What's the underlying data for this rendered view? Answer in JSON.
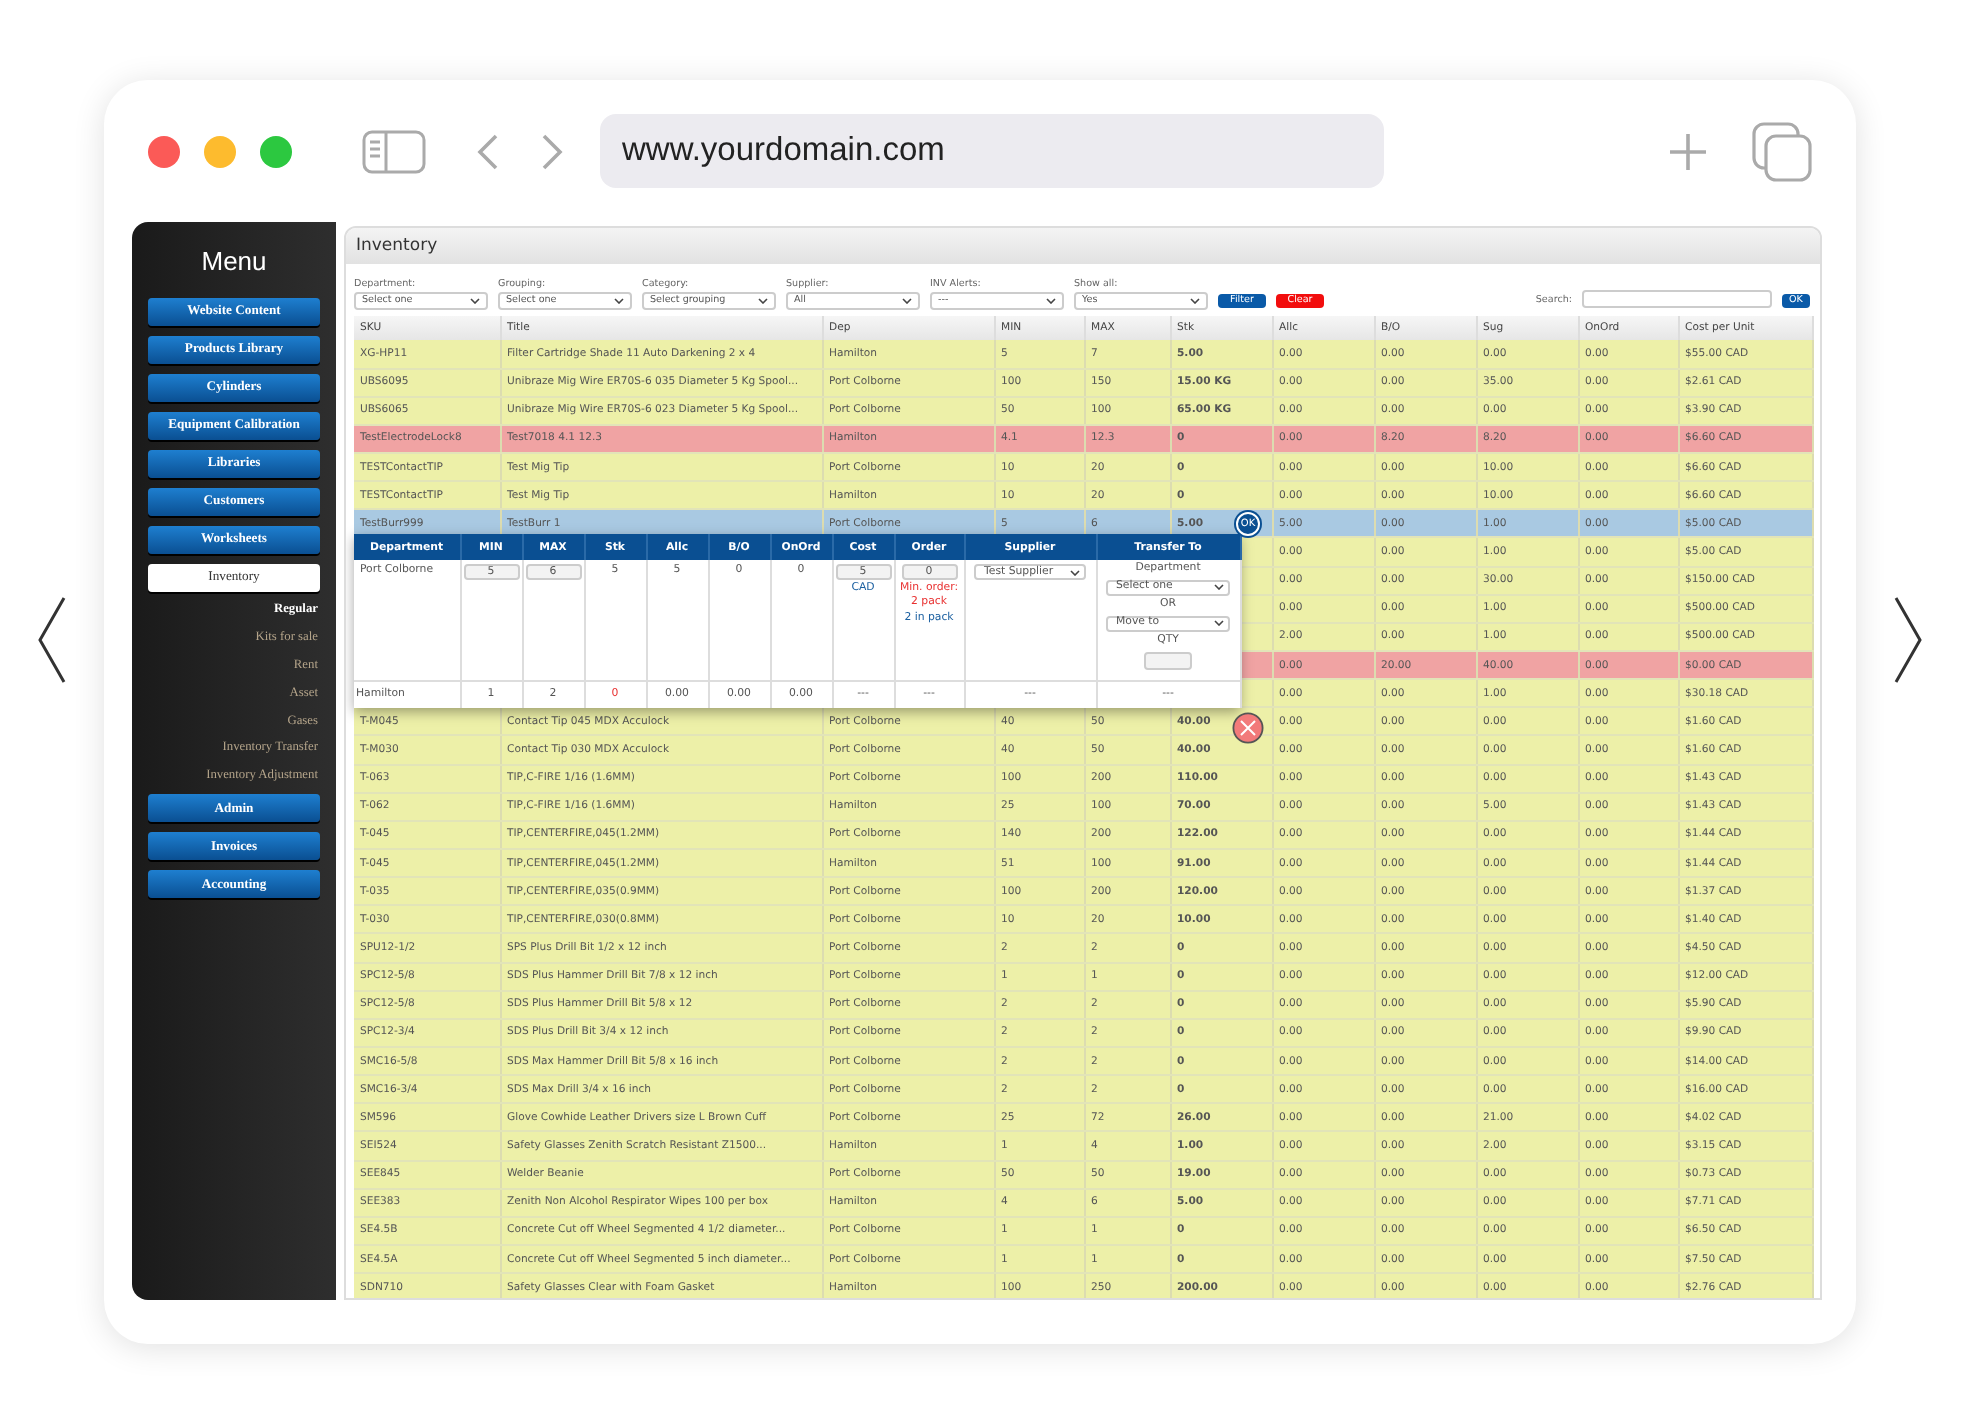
{
  "browser": {
    "url": "www.yourdomain.com"
  },
  "sidebar": {
    "title": "Menu",
    "items": [
      {
        "label": "Website Content",
        "kind": "button",
        "selected": false
      },
      {
        "label": "Products Library",
        "kind": "button",
        "selected": false
      },
      {
        "label": "Cylinders",
        "kind": "button",
        "selected": false
      },
      {
        "label": "Equipment Calibration",
        "kind": "button",
        "selected": false
      },
      {
        "label": "Libraries",
        "kind": "button",
        "selected": false
      },
      {
        "label": "Customers",
        "kind": "button",
        "selected": false
      },
      {
        "label": "Worksheets",
        "kind": "button",
        "selected": false
      },
      {
        "label": "Inventory",
        "kind": "button",
        "selected": true
      },
      {
        "label": "Regular",
        "kind": "subitem",
        "selected": true
      },
      {
        "label": "Kits for sale",
        "kind": "subitem",
        "selected": false
      },
      {
        "label": "Rent",
        "kind": "subitem",
        "selected": false
      },
      {
        "label": "Asset",
        "kind": "subitem",
        "selected": false
      },
      {
        "label": "Gases",
        "kind": "subitem",
        "selected": false
      },
      {
        "label": "Inventory Transfer",
        "kind": "subitem",
        "selected": false
      },
      {
        "label": "Inventory Adjustment",
        "kind": "subitem",
        "selected": false
      },
      {
        "label": "Admin",
        "kind": "button",
        "selected": false
      },
      {
        "label": "Invoices",
        "kind": "button",
        "selected": false
      },
      {
        "label": "Accounting",
        "kind": "button",
        "selected": false
      }
    ]
  },
  "panel": {
    "title": "Inventory"
  },
  "filters": [
    {
      "label": "Department:",
      "value": "Select one"
    },
    {
      "label": "Grouping:",
      "value": "Select one"
    },
    {
      "label": "Category:",
      "value": "Select grouping"
    },
    {
      "label": "Supplier:",
      "value": "All"
    },
    {
      "label": "INV Alerts:",
      "value": "---"
    },
    {
      "label": "Show all:",
      "value": "Yes"
    }
  ],
  "buttons": [
    {
      "label": "Filter",
      "kind": "primary"
    },
    {
      "label": "Clear",
      "kind": "danger"
    }
  ],
  "search": {
    "label": "Search:",
    "button": "OK"
  },
  "table": {
    "columns": [
      "SKU",
      "Title",
      "Dep",
      "MIN",
      "MAX",
      "Stk",
      "Allc",
      "B/O",
      "Sug",
      "OnOrd",
      "Cost per Unit"
    ],
    "rows": [
      {
        "alert": false,
        "selected": false,
        "cells": [
          "XG-HP11",
          "Filter Cartridge Shade 11 Auto Darkening 2 x 4",
          "Hamilton",
          "5",
          "7",
          "5.00",
          "0.00",
          "0.00",
          "0.00",
          "0.00",
          "$55.00 CAD"
        ]
      },
      {
        "alert": false,
        "selected": false,
        "cells": [
          "UBS6095",
          "Unibraze Mig Wire ER70S-6 035 Diameter 5 Kg Spool...",
          "Port Colborne",
          "100",
          "150",
          "15.00 KG",
          "0.00",
          "0.00",
          "35.00",
          "0.00",
          "$2.61 CAD"
        ]
      },
      {
        "alert": false,
        "selected": false,
        "cells": [
          "UBS6065",
          "Unibraze Mig Wire ER70S-6 023 Diameter 5 Kg Spool...",
          "Port Colborne",
          "50",
          "100",
          "65.00 KG",
          "0.00",
          "0.00",
          "0.00",
          "0.00",
          "$3.90 CAD"
        ]
      },
      {
        "alert": true,
        "selected": false,
        "cells": [
          "TestElectrodeLock8",
          "Test7018 4.1 12.3",
          "Hamilton",
          "4.1",
          "12.3",
          "0",
          "0.00",
          "8.20",
          "8.20",
          "0.00",
          "$6.60 CAD"
        ]
      },
      {
        "alert": false,
        "selected": false,
        "cells": [
          "TESTContactTIP",
          "Test Mig Tip",
          "Port Colborne",
          "10",
          "20",
          "0",
          "0.00",
          "0.00",
          "10.00",
          "0.00",
          "$6.60 CAD"
        ]
      },
      {
        "alert": false,
        "selected": false,
        "cells": [
          "TESTContactTIP",
          "Test Mig Tip",
          "Hamilton",
          "10",
          "20",
          "0",
          "0.00",
          "0.00",
          "10.00",
          "0.00",
          "$6.60 CAD"
        ]
      },
      {
        "alert": false,
        "selected": true,
        "cells": [
          "TestBurr999",
          "TestBurr 1",
          "Port Colborne",
          "5",
          "6",
          "5.00",
          "5.00",
          "0.00",
          "1.00",
          "0.00",
          "$5.00 CAD"
        ]
      },
      {
        "alert": false,
        "selected": false,
        "cells": [
          "0.00",
          "0.00",
          "1.00",
          "0.00",
          "$5.00 CAD"
        ]
      },
      {
        "alert": false,
        "selected": false,
        "cells": [
          "0.00",
          "0.00",
          "30.00",
          "0.00",
          "$150.00 CAD"
        ]
      },
      {
        "alert": false,
        "selected": false,
        "cells": [
          "0.00",
          "0.00",
          "1.00",
          "0.00",
          "$500.00 CAD"
        ]
      },
      {
        "alert": false,
        "selected": false,
        "cells": [
          "2.00",
          "0.00",
          "1.00",
          "0.00",
          "$500.00 CAD"
        ]
      },
      {
        "alert": true,
        "selected": false,
        "cells": [
          "0.00",
          "20.00",
          "40.00",
          "0.00",
          "$0.00 CAD"
        ]
      },
      {
        "alert": false,
        "selected": false,
        "cells": [
          "0.00",
          "0.00",
          "1.00",
          "0.00",
          "$30.18 CAD"
        ]
      },
      {
        "alert": false,
        "selected": false,
        "cells": [
          "T-M045",
          "Contact Tip 045 MDX Acculock",
          "Port Colborne",
          "40",
          "50",
          "40.00",
          "0.00",
          "0.00",
          "0.00",
          "0.00",
          "$1.60 CAD"
        ]
      },
      {
        "alert": false,
        "selected": false,
        "cells": [
          "T-M030",
          "Contact Tip 030 MDX Acculock",
          "Port Colborne",
          "40",
          "50",
          "40.00",
          "0.00",
          "0.00",
          "0.00",
          "0.00",
          "$1.60 CAD"
        ]
      },
      {
        "alert": false,
        "selected": false,
        "cells": [
          "T-063",
          "TIP,C-FIRE 1/16 (1.6MM)",
          "Port Colborne",
          "100",
          "200",
          "110.00",
          "0.00",
          "0.00",
          "0.00",
          "0.00",
          "$1.43 CAD"
        ]
      },
      {
        "alert": false,
        "selected": false,
        "cells": [
          "T-062",
          "TIP,C-FIRE 1/16 (1.6MM)",
          "Hamilton",
          "25",
          "100",
          "70.00",
          "0.00",
          "0.00",
          "5.00",
          "0.00",
          "$1.43 CAD"
        ]
      },
      {
        "alert": false,
        "selected": false,
        "cells": [
          "T-045",
          "TIP,CENTERFIRE,045(1.2MM)",
          "Port Colborne",
          "140",
          "200",
          "122.00",
          "0.00",
          "0.00",
          "0.00",
          "0.00",
          "$1.44 CAD"
        ]
      },
      {
        "alert": false,
        "selected": false,
        "cells": [
          "T-045",
          "TIP,CENTERFIRE,045(1.2MM)",
          "Hamilton",
          "51",
          "100",
          "91.00",
          "0.00",
          "0.00",
          "0.00",
          "0.00",
          "$1.44 CAD"
        ]
      },
      {
        "alert": false,
        "selected": false,
        "cells": [
          "T-035",
          "TIP,CENTERFIRE,035(0.9MM)",
          "Port Colborne",
          "100",
          "200",
          "120.00",
          "0.00",
          "0.00",
          "0.00",
          "0.00",
          "$1.37 CAD"
        ]
      },
      {
        "alert": false,
        "selected": false,
        "cells": [
          "T-030",
          "TIP,CENTERFIRE,030(0.8MM)",
          "Port Colborne",
          "10",
          "20",
          "10.00",
          "0.00",
          "0.00",
          "0.00",
          "0.00",
          "$1.40 CAD"
        ]
      },
      {
        "alert": false,
        "selected": false,
        "cells": [
          "SPU12-1/2",
          "SPS Plus Drill Bit 1/2 x 12 inch",
          "Port Colborne",
          "2",
          "2",
          "0",
          "0.00",
          "0.00",
          "0.00",
          "0.00",
          "$4.50 CAD"
        ]
      },
      {
        "alert": false,
        "selected": false,
        "cells": [
          "SPC12-5/8",
          "SDS Plus Hammer Drill Bit 7/8 x 12 inch",
          "Port Colborne",
          "1",
          "1",
          "0",
          "0.00",
          "0.00",
          "0.00",
          "0.00",
          "$12.00 CAD"
        ]
      },
      {
        "alert": false,
        "selected": false,
        "cells": [
          "SPC12-5/8",
          "SDS Plus Hammer Drill Bit 5/8 x 12",
          "Port Colborne",
          "2",
          "2",
          "0",
          "0.00",
          "0.00",
          "0.00",
          "0.00",
          "$5.90 CAD"
        ]
      },
      {
        "alert": false,
        "selected": false,
        "cells": [
          "SPC12-3/4",
          "SDS Plus Drill Bit 3/4 x 12 inch",
          "Port Colborne",
          "2",
          "2",
          "0",
          "0.00",
          "0.00",
          "0.00",
          "0.00",
          "$9.90 CAD"
        ]
      },
      {
        "alert": false,
        "selected": false,
        "cells": [
          "SMC16-5/8",
          "SDS Max Hammer Drill Bit 5/8 x 16 inch",
          "Port Colborne",
          "2",
          "2",
          "0",
          "0.00",
          "0.00",
          "0.00",
          "0.00",
          "$14.00 CAD"
        ]
      },
      {
        "alert": false,
        "selected": false,
        "cells": [
          "SMC16-3/4",
          "SDS Max Drill 3/4 x 16 inch",
          "Port Colborne",
          "2",
          "2",
          "0",
          "0.00",
          "0.00",
          "0.00",
          "0.00",
          "$16.00 CAD"
        ]
      },
      {
        "alert": false,
        "selected": false,
        "cells": [
          "SM596",
          "Glove Cowhide Leather Drivers size L Brown Cuff",
          "Port Colborne",
          "25",
          "72",
          "26.00",
          "0.00",
          "0.00",
          "21.00",
          "0.00",
          "$4.02 CAD"
        ]
      },
      {
        "alert": false,
        "selected": false,
        "cells": [
          "SEI524",
          "Safety Glasses Zenith Scratch Resistant Z1500...",
          "Hamilton",
          "1",
          "4",
          "1.00",
          "0.00",
          "0.00",
          "2.00",
          "0.00",
          "$3.15 CAD"
        ]
      },
      {
        "alert": false,
        "selected": false,
        "cells": [
          "SEE845",
          "Welder Beanie",
          "Port Colborne",
          "50",
          "50",
          "19.00",
          "0.00",
          "0.00",
          "0.00",
          "0.00",
          "$0.73 CAD"
        ]
      },
      {
        "alert": false,
        "selected": false,
        "cells": [
          "SEE383",
          "Zenith Non Alcohol Respirator Wipes 100 per box",
          "Hamilton",
          "4",
          "6",
          "5.00",
          "0.00",
          "0.00",
          "0.00",
          "0.00",
          "$7.71 CAD"
        ]
      },
      {
        "alert": false,
        "selected": false,
        "cells": [
          "SE4.5B",
          "Concrete Cut off Wheel Segmented 4 1/2 diameter...",
          "Port Colborne",
          "1",
          "1",
          "0",
          "0.00",
          "0.00",
          "0.00",
          "0.00",
          "$6.50 CAD"
        ]
      },
      {
        "alert": false,
        "selected": false,
        "cells": [
          "SE4.5A",
          "Concrete Cut off Wheel Segmented 5 inch diameter...",
          "Port Colborne",
          "1",
          "1",
          "0",
          "0.00",
          "0.00",
          "0.00",
          "0.00",
          "$7.50 CAD"
        ]
      },
      {
        "alert": false,
        "selected": false,
        "cells": [
          "SDN710",
          "Safety Glasses Clear with Foam Gasket",
          "Hamilton",
          "100",
          "250",
          "200.00",
          "0.00",
          "0.00",
          "0.00",
          "0.00",
          "$2.76 CAD"
        ]
      }
    ]
  },
  "popup": {
    "ok": "OK",
    "columns": [
      "Department",
      "MIN",
      "MAX",
      "Stk",
      "Allc",
      "B/O",
      "OnOrd",
      "Cost",
      "Order",
      "Supplier",
      "Transfer To"
    ],
    "rows": [
      {
        "kind": "edit",
        "department": "Port Colborne",
        "min": "5",
        "max": "6",
        "stk": "5",
        "stk_low": false,
        "allc": "5",
        "bo": "0",
        "onord": "0",
        "cost": "5",
        "currency": "CAD",
        "order": "0",
        "min_order": [
          "Min. order:",
          "2 pack"
        ],
        "pack": "2 in pack",
        "supplier": "Test Supplier",
        "transfer": {
          "department_label": "Department",
          "department": "Select one",
          "or": "OR",
          "move": "Move to",
          "qty_label": "QTY"
        }
      },
      {
        "kind": "summary",
        "department": "Hamilton",
        "min": "1",
        "max": "2",
        "stk": "0",
        "stk_low": true,
        "allc": "0.00",
        "bo": "0.00",
        "onord": "0.00",
        "cost": "---",
        "order": "---",
        "supplier": "---",
        "transfer": "---"
      }
    ]
  }
}
